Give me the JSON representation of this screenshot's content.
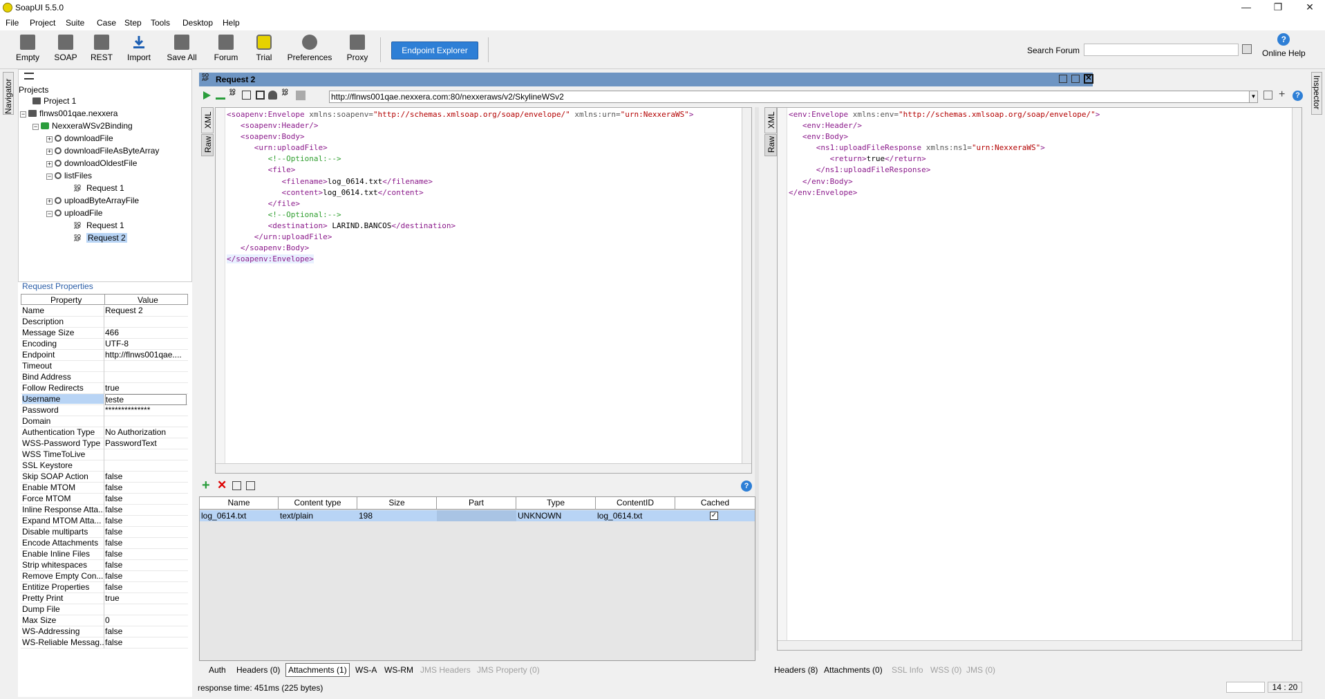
{
  "window": {
    "title": "SoapUI 5.5.0",
    "minimize": "—",
    "restore": "❐",
    "close": "✕"
  },
  "menu": [
    "File",
    "Project",
    "Suite",
    "Case",
    "Step",
    "Tools",
    "Desktop",
    "Help"
  ],
  "toolbar": {
    "items": [
      "Empty",
      "SOAP",
      "REST",
      "Import",
      "Save All",
      "Forum",
      "Trial",
      "Preferences",
      "Proxy"
    ],
    "endpoint_explorer": "Endpoint Explorer",
    "search_label": "Search Forum",
    "search_placeholder": "",
    "online_help": "Online Help",
    "help_glyph": "?"
  },
  "side_tabs": {
    "navigator": "Navigator",
    "inspector": "Inspector"
  },
  "navigator": {
    "root": "Projects",
    "items": [
      {
        "label": "Project 1"
      },
      {
        "label": "flnws001qae.nexxera"
      },
      {
        "label": "NexxeraWSv2Binding"
      },
      {
        "label": "downloadFile"
      },
      {
        "label": "downloadFileAsByteArray"
      },
      {
        "label": "downloadOldestFile"
      },
      {
        "label": "listFiles"
      },
      {
        "label": "Request 1"
      },
      {
        "label": "uploadByteArrayFile"
      },
      {
        "label": "uploadFile"
      },
      {
        "label": "Request 1"
      },
      {
        "label": "Request 2"
      }
    ]
  },
  "properties": {
    "title": "Request Properties",
    "col_property": "Property",
    "col_value": "Value",
    "rows": [
      [
        "Name",
        "Request 2"
      ],
      [
        "Description",
        ""
      ],
      [
        "Message Size",
        "466"
      ],
      [
        "Encoding",
        "UTF-8"
      ],
      [
        "Endpoint",
        "http://flnws001qae...."
      ],
      [
        "Timeout",
        ""
      ],
      [
        "Bind Address",
        ""
      ],
      [
        "Follow Redirects",
        "true"
      ],
      [
        "Username",
        "teste"
      ],
      [
        "Password",
        "**************"
      ],
      [
        "Domain",
        ""
      ],
      [
        "Authentication Type",
        "No Authorization"
      ],
      [
        "WSS-Password Type",
        "PasswordText"
      ],
      [
        "WSS TimeToLive",
        ""
      ],
      [
        "SSL Keystore",
        ""
      ],
      [
        "Skip SOAP Action",
        "false"
      ],
      [
        "Enable MTOM",
        "false"
      ],
      [
        "Force MTOM",
        "false"
      ],
      [
        "Inline Response Atta...",
        "false"
      ],
      [
        "Expand MTOM Atta...",
        "false"
      ],
      [
        "Disable multiparts",
        "false"
      ],
      [
        "Encode Attachments",
        "false"
      ],
      [
        "Enable Inline Files",
        "false"
      ],
      [
        "Strip whitespaces",
        "false"
      ],
      [
        "Remove Empty Con...",
        "false"
      ],
      [
        "Entitize Properties",
        "false"
      ],
      [
        "Pretty Print",
        "true"
      ],
      [
        "Dump File",
        ""
      ],
      [
        "Max Size",
        "0"
      ],
      [
        "WS-Addressing",
        "false"
      ],
      [
        "WS-Reliable Messag...",
        "false"
      ]
    ]
  },
  "request": {
    "title": "Request 2",
    "url": "http://flnws001qae.nexxera.com:80/nexxeraws/v2/SkylineWSv2",
    "tabs": {
      "xml": "XML",
      "raw": "Raw"
    }
  },
  "attachments": {
    "columns": [
      "Name",
      "Content type",
      "Size",
      "Part",
      "Type",
      "ContentID",
      "Cached"
    ],
    "rows": [
      [
        "log_0614.txt",
        "text/plain",
        "198",
        "",
        "UNKNOWN",
        "log_0614.txt",
        "✓"
      ]
    ],
    "help_glyph": "?"
  },
  "request_tabs": [
    {
      "label": "Auth",
      "state": "normal"
    },
    {
      "label": "Headers (0)",
      "state": "normal"
    },
    {
      "label": "Attachments (1)",
      "state": "selected"
    },
    {
      "label": "WS-A",
      "state": "normal"
    },
    {
      "label": "WS-RM",
      "state": "normal"
    },
    {
      "label": "JMS Headers",
      "state": "disabled"
    },
    {
      "label": "JMS Property (0)",
      "state": "disabled"
    }
  ],
  "response_tabs": [
    {
      "label": "Headers (8)",
      "state": "normal"
    },
    {
      "label": "Attachments (0)",
      "state": "normal"
    },
    {
      "label": "SSL Info",
      "state": "disabled"
    },
    {
      "label": "WSS (0)",
      "state": "disabled"
    },
    {
      "label": "JMS (0)",
      "state": "disabled"
    }
  ],
  "status": {
    "response_time": "response time: 451ms (225 bytes)",
    "cursor": "14 : 20"
  }
}
